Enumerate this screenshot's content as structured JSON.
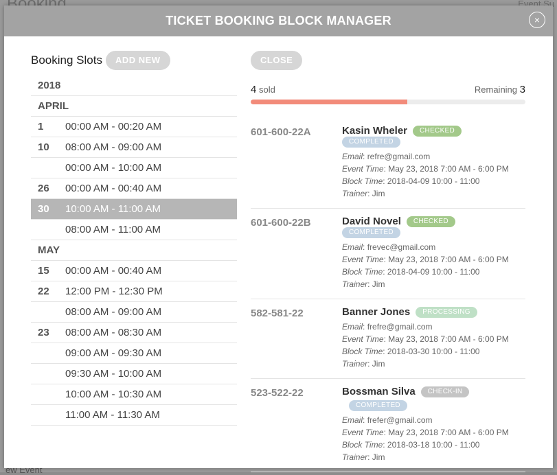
{
  "background": {
    "top_left": "Booking",
    "top_right": "Event Su",
    "bottom_left": "ew Event"
  },
  "modal": {
    "title": "TICKET BOOKING BLOCK MANAGER",
    "close_icon": "×"
  },
  "left": {
    "title": "Booking Slots",
    "add_label": "ADD NEW",
    "rows": [
      {
        "type": "header",
        "text": "2018"
      },
      {
        "type": "header",
        "text": "APRIL"
      },
      {
        "type": "slot",
        "day": "1",
        "time": "00:00 AM - 00:20 AM",
        "selected": false
      },
      {
        "type": "slot",
        "day": "10",
        "time": "08:00 AM - 09:00 AM",
        "selected": false
      },
      {
        "type": "slot",
        "day": "",
        "time": "00:00 AM - 10:00 AM",
        "selected": false
      },
      {
        "type": "slot",
        "day": "26",
        "time": "00:00 AM - 00:40 AM",
        "selected": false
      },
      {
        "type": "slot",
        "day": "30",
        "time": "10:00 AM - 11:00 AM",
        "selected": true
      },
      {
        "type": "slot",
        "day": "",
        "time": "08:00 AM - 11:00 AM",
        "selected": false
      },
      {
        "type": "header",
        "text": "MAY"
      },
      {
        "type": "slot",
        "day": "15",
        "time": "00:00 AM - 00:40 AM",
        "selected": false
      },
      {
        "type": "slot",
        "day": "22",
        "time": "12:00 PM - 12:30 PM",
        "selected": false
      },
      {
        "type": "slot",
        "day": "",
        "time": "08:00 AM - 09:00 AM",
        "selected": false
      },
      {
        "type": "slot",
        "day": "23",
        "time": "08:00 AM - 08:30 AM",
        "selected": false
      },
      {
        "type": "slot",
        "day": "",
        "time": "09:00 AM - 09:30 AM",
        "selected": false
      },
      {
        "type": "slot",
        "day": "",
        "time": "09:30 AM - 10:00 AM",
        "selected": false
      },
      {
        "type": "slot",
        "day": "",
        "time": "10:00 AM - 10:30 AM",
        "selected": false
      },
      {
        "type": "slot",
        "day": "",
        "time": "11:00 AM - 11:30 AM",
        "selected": false
      }
    ]
  },
  "right": {
    "close_label": "CLOSE",
    "sold_count": "4",
    "sold_label": "sold",
    "remaining_label": "Remaining",
    "remaining_count": "3",
    "progress_fraction": 0.57,
    "labels": {
      "email": "Email",
      "event_time": "Event Time",
      "block_time": "Block Time",
      "trainer": "Trainer"
    },
    "tickets": [
      {
        "id": "601-600-22A",
        "name": "Kasin Wheler",
        "badges": [
          {
            "text": "CHECKED",
            "color": "#a3c98a"
          },
          {
            "text": "COMPLETED",
            "color": "#c3d4e4"
          }
        ],
        "email": "refre@gmail.com",
        "event_time": "May 23, 2018 7:00 AM - 6:00 PM",
        "block_time": "2018-04-09 10:00 - 11:00",
        "trainer": "Jim"
      },
      {
        "id": "601-600-22B",
        "name": "David Novel",
        "badges": [
          {
            "text": "CHECKED",
            "color": "#a3c98a"
          },
          {
            "text": "COMPLETED",
            "color": "#c3d4e4"
          }
        ],
        "email": "frevec@gmail.com",
        "event_time": "May 23, 2018 7:00 AM - 6:00 PM",
        "block_time": "2018-04-09 10:00 - 11:00",
        "trainer": "Jim"
      },
      {
        "id": "582-581-22",
        "name": "Banner Jones",
        "badges": [
          {
            "text": "PROCESSING",
            "color": "#bfe0c6"
          }
        ],
        "email": "frefre@gmail.com",
        "event_time": "May 23, 2018 7:00 AM - 6:00 PM",
        "block_time": "2018-03-30 10:00 - 11:00",
        "trainer": "Jim"
      },
      {
        "id": "523-522-22",
        "name": "Bossman Silva",
        "badges": [
          {
            "text": "CHECK-IN",
            "color": "#c4c4c4"
          },
          {
            "text": "COMPLETED",
            "color": "#c3d4e4"
          }
        ],
        "email": "frefer@gmail.com",
        "event_time": "May 23, 2018 7:00 AM - 6:00 PM",
        "block_time": "2018-03-18 10:00 - 11:00",
        "trainer": "Jim"
      }
    ]
  }
}
